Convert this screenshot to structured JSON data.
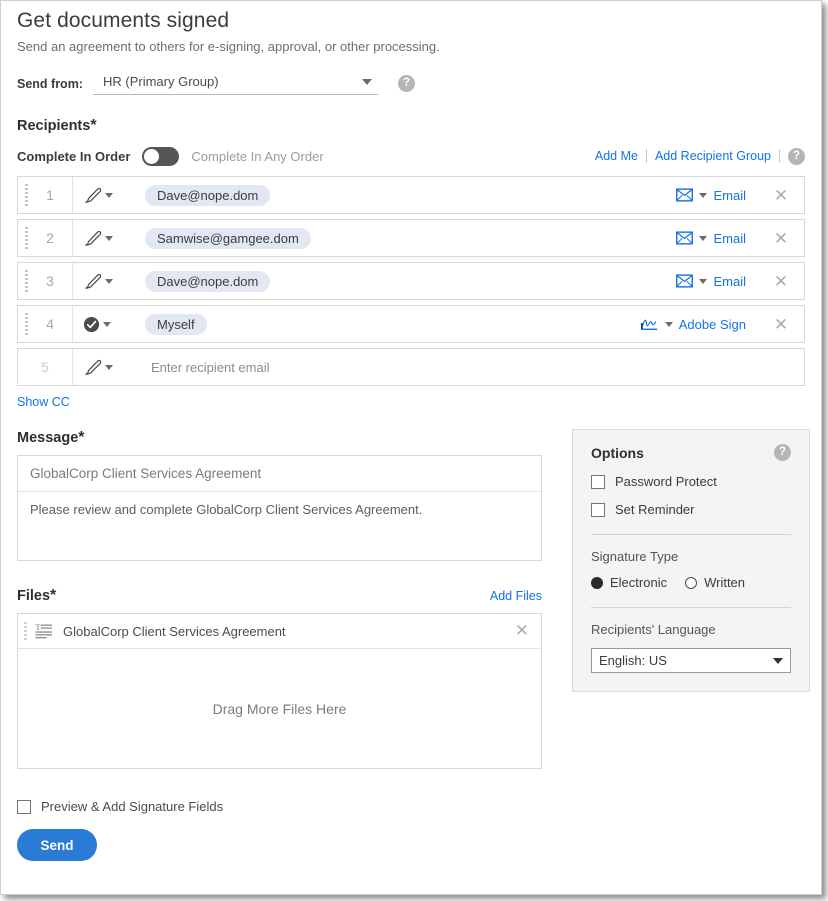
{
  "header": {
    "title": "Get documents signed",
    "subtitle": "Send an agreement to others for e-signing, approval, or other processing.",
    "send_from_label": "Send from:",
    "send_from_value": "HR (Primary Group)",
    "help_glyph": "?"
  },
  "recipients": {
    "section_label": "Recipients",
    "required_mark": "*",
    "order_on_label": "Complete In Order",
    "order_off_label": "Complete In Any Order",
    "order_toggle_state": "off",
    "add_me_label": "Add Me",
    "add_recipient_group_label": "Add Recipient Group",
    "show_cc_label": "Show CC",
    "rows": [
      {
        "index": "1",
        "role_icon": "signature-pen-icon",
        "value": "Dave@nope.dom",
        "is_pill": true,
        "method_icon": "envelope-icon",
        "method_label": "Email",
        "has_close": true
      },
      {
        "index": "2",
        "role_icon": "signature-pen-icon",
        "value": "Samwise@gamgee.dom",
        "is_pill": true,
        "method_icon": "envelope-icon",
        "method_label": "Email",
        "has_close": true
      },
      {
        "index": "3",
        "role_icon": "signature-pen-icon",
        "value": "Dave@nope.dom",
        "is_pill": true,
        "method_icon": "envelope-icon",
        "method_label": "Email",
        "has_close": true
      },
      {
        "index": "4",
        "role_icon": "approver-check-icon",
        "value": "Myself",
        "is_pill": true,
        "method_icon": "adobe-sign-icon",
        "method_label": "Adobe Sign",
        "has_close": true
      },
      {
        "index": "5",
        "role_icon": "signature-pen-icon",
        "value": "Enter recipient email",
        "is_pill": false,
        "method_icon": "",
        "method_label": "",
        "has_close": false
      }
    ]
  },
  "message": {
    "section_label": "Message",
    "required_mark": "*",
    "subject": "GlobalCorp Client Services Agreement",
    "body": "Please review and complete GlobalCorp Client Services Agreement."
  },
  "files": {
    "section_label": "Files",
    "required_mark": "*",
    "add_files_label": "Add Files",
    "items": [
      {
        "name": "GlobalCorp Client Services Agreement",
        "icon": "document-text-icon"
      }
    ],
    "dropzone_label": "Drag More Files Here"
  },
  "options": {
    "title": "Options",
    "help_glyph": "?",
    "checkboxes": [
      {
        "label": "Password Protect",
        "checked": false
      },
      {
        "label": "Set Reminder",
        "checked": false
      }
    ],
    "signature_type_label": "Signature Type",
    "signature_options": [
      {
        "label": "Electronic",
        "checked": true
      },
      {
        "label": "Written",
        "checked": false
      }
    ],
    "language_label": "Recipients' Language",
    "language_value": "English: US"
  },
  "footer": {
    "preview_label": "Preview & Add Signature Fields",
    "preview_checked": false,
    "send_label": "Send"
  },
  "colors": {
    "link": "#1473e6",
    "send_button": "#2a7bd6",
    "pill_bg": "#e1e8f4",
    "panel_bg": "#f4f4f4"
  }
}
